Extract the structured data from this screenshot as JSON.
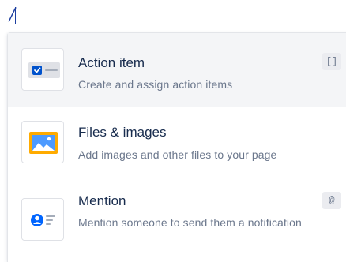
{
  "editor": {
    "typed_text": "/"
  },
  "menu": {
    "items": [
      {
        "icon": "action-item-checkbox-icon",
        "title": "Action item",
        "description": "Create and assign action items",
        "shortcut": "[]",
        "selected": true
      },
      {
        "icon": "image-icon",
        "title": "Files & images",
        "description": "Add images and other files to your page",
        "shortcut": "",
        "selected": false
      },
      {
        "icon": "mention-user-icon",
        "title": "Mention",
        "description": "Mention someone to send them a notification",
        "shortcut": "@",
        "selected": false
      }
    ]
  },
  "colors": {
    "selected_row_bg": "#f4f5f7",
    "checkbox_blue": "#0052cc",
    "image_frame_orange": "#ffab00",
    "title_text": "#172b4d",
    "description_text": "#6b778c"
  }
}
